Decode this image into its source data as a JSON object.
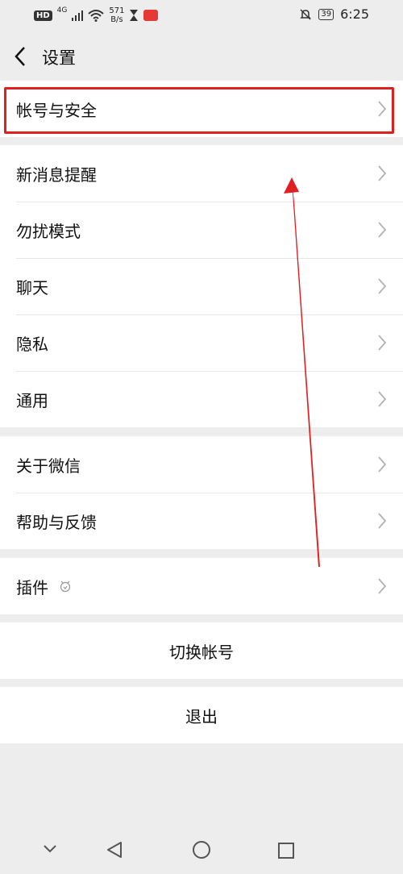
{
  "status_bar": {
    "hd": "HD",
    "network": "4G",
    "speed_value": "571",
    "speed_unit": "B/s",
    "battery": "39",
    "time": "6:25"
  },
  "header": {
    "title": "设置"
  },
  "groups": {
    "account": [
      "帐号与安全"
    ],
    "main": [
      "新消息提醒",
      "勿扰模式",
      "聊天",
      "隐私",
      "通用"
    ],
    "about": [
      "关于微信",
      "帮助与反馈"
    ],
    "plugins": [
      "插件"
    ]
  },
  "actions": {
    "switch_account": "切换帐号",
    "logout": "退出"
  },
  "annotation": {
    "highlight_color": "#e02020"
  }
}
